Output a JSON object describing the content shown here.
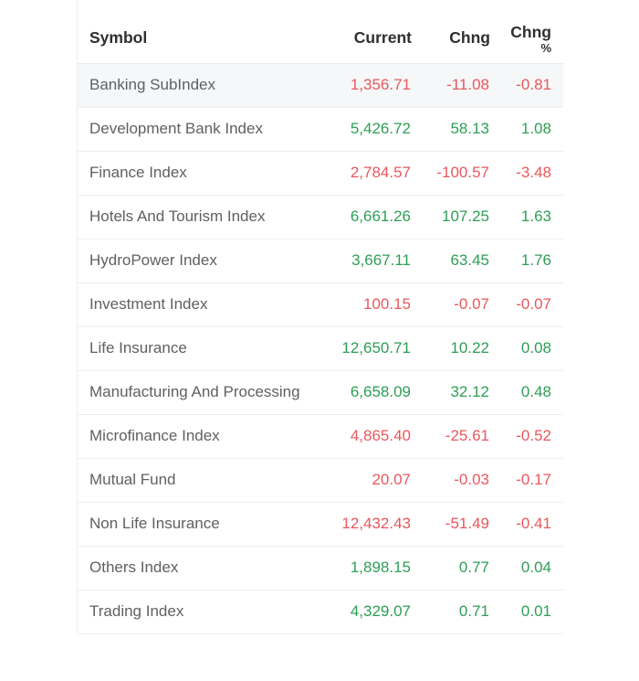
{
  "table": {
    "columns": [
      {
        "key": "symbol",
        "label": "Symbol",
        "align": "left"
      },
      {
        "key": "current",
        "label": "Current",
        "align": "right"
      },
      {
        "key": "chng",
        "label": "Chng",
        "align": "right"
      },
      {
        "key": "chngpct",
        "label": "Chng",
        "label2": "%",
        "align": "right"
      }
    ],
    "colors": {
      "up": "#2e9e55",
      "down": "#e8585d",
      "symbol_text": "#5e6063",
      "header_text": "#2d2f31",
      "row_border": "#eceef0",
      "row_shaded_bg": "#f6f7f8",
      "row_bg": "#ffffff"
    },
    "rows": [
      {
        "symbol": "Banking SubIndex",
        "current": "1,356.71",
        "chng": "-11.08",
        "chngpct": "-0.81",
        "direction": "down",
        "shaded": true
      },
      {
        "symbol": "Development Bank Index",
        "current": "5,426.72",
        "chng": "58.13",
        "chngpct": "1.08",
        "direction": "up",
        "shaded": false
      },
      {
        "symbol": "Finance Index",
        "current": "2,784.57",
        "chng": "-100.57",
        "chngpct": "-3.48",
        "direction": "down",
        "shaded": false
      },
      {
        "symbol": "Hotels And Tourism Index",
        "current": "6,661.26",
        "chng": "107.25",
        "chngpct": "1.63",
        "direction": "up",
        "shaded": false
      },
      {
        "symbol": "HydroPower Index",
        "current": "3,667.11",
        "chng": "63.45",
        "chngpct": "1.76",
        "direction": "up",
        "shaded": false
      },
      {
        "symbol": "Investment Index",
        "current": "100.15",
        "chng": "-0.07",
        "chngpct": "-0.07",
        "direction": "down",
        "shaded": false
      },
      {
        "symbol": "Life Insurance",
        "current": "12,650.71",
        "chng": "10.22",
        "chngpct": "0.08",
        "direction": "up",
        "shaded": false
      },
      {
        "symbol": "Manufacturing And Processing",
        "current": "6,658.09",
        "chng": "32.12",
        "chngpct": "0.48",
        "direction": "up",
        "shaded": false
      },
      {
        "symbol": "Microfinance Index",
        "current": "4,865.40",
        "chng": "-25.61",
        "chngpct": "-0.52",
        "direction": "down",
        "shaded": false
      },
      {
        "symbol": "Mutual Fund",
        "current": "20.07",
        "chng": "-0.03",
        "chngpct": "-0.17",
        "direction": "down",
        "shaded": false
      },
      {
        "symbol": "Non Life Insurance",
        "current": "12,432.43",
        "chng": "-51.49",
        "chngpct": "-0.41",
        "direction": "down",
        "shaded": false
      },
      {
        "symbol": "Others Index",
        "current": "1,898.15",
        "chng": "0.77",
        "chngpct": "0.04",
        "direction": "up",
        "shaded": false
      },
      {
        "symbol": "Trading Index",
        "current": "4,329.07",
        "chng": "0.71",
        "chngpct": "0.01",
        "direction": "up",
        "shaded": false
      }
    ]
  }
}
